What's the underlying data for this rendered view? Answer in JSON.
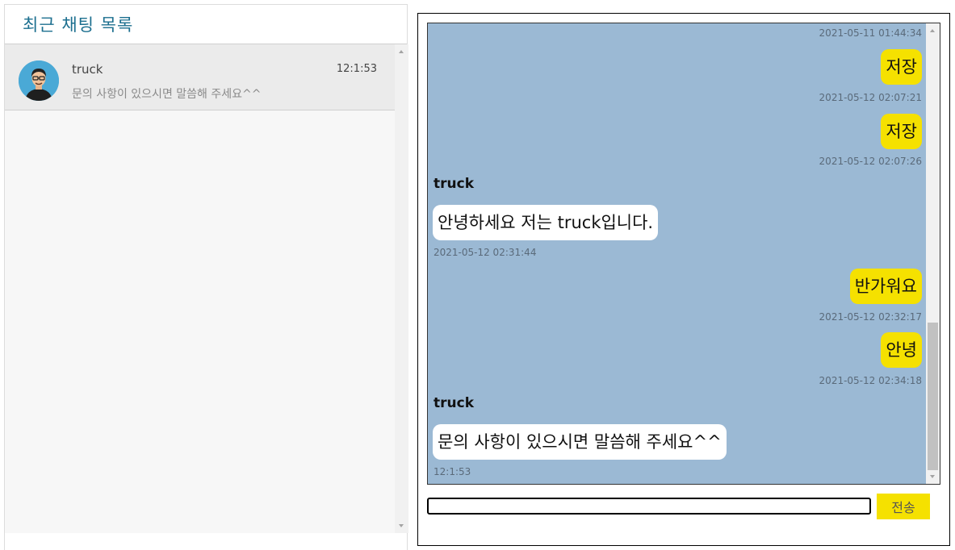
{
  "left": {
    "title": "최근 채팅 목록",
    "chats": [
      {
        "name": "truck",
        "time": "12:1:53",
        "preview": "문의 사항이 있으시면 말씀해 주세요^^"
      }
    ]
  },
  "messages": [
    {
      "type": "timestamp",
      "side": "right",
      "text": "2021-05-11 01:44:34"
    },
    {
      "type": "bubble",
      "side": "me",
      "text": "저장"
    },
    {
      "type": "timestamp",
      "side": "right",
      "text": "2021-05-12 02:07:21"
    },
    {
      "type": "bubble",
      "side": "me",
      "text": "저장"
    },
    {
      "type": "timestamp",
      "side": "right",
      "text": "2021-05-12 02:07:26"
    },
    {
      "type": "sender",
      "text": "truck"
    },
    {
      "type": "bubble",
      "side": "them",
      "text": "안녕하세요 저는 truck입니다."
    },
    {
      "type": "timestamp",
      "side": "left",
      "text": "2021-05-12 02:31:44"
    },
    {
      "type": "bubble",
      "side": "me",
      "text": "반가워요"
    },
    {
      "type": "timestamp",
      "side": "right",
      "text": "2021-05-12 02:32:17"
    },
    {
      "type": "bubble",
      "side": "me",
      "text": "안녕"
    },
    {
      "type": "timestamp",
      "side": "right",
      "text": "2021-05-12 02:34:18"
    },
    {
      "type": "sender",
      "text": "truck"
    },
    {
      "type": "bubble",
      "side": "them",
      "text": "문의 사항이 있으시면 말씀해 주세요^^"
    },
    {
      "type": "timestamp",
      "side": "left",
      "text": "12:1:53"
    }
  ],
  "input": {
    "value": "",
    "placeholder": ""
  },
  "send_label": "전송",
  "colors": {
    "chat_bg": "#9bb9d4",
    "my_bubble": "#f5e100",
    "their_bubble": "#ffffff",
    "title": "#1c6f8f"
  }
}
